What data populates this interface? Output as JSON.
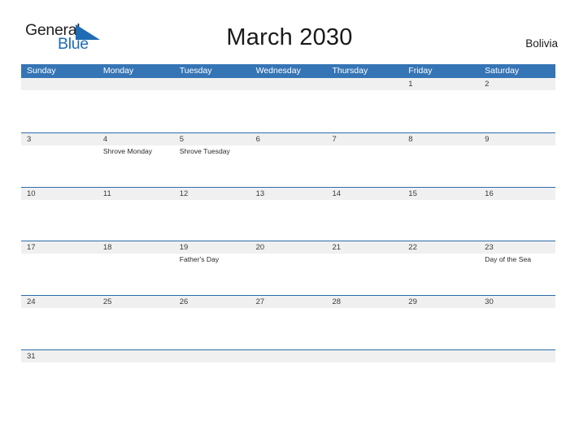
{
  "brand": {
    "name_part1": "General",
    "name_part2": "Blue",
    "flag_icon": "triangle-flag-icon",
    "color_dark": "#231f20",
    "color_blue": "#1f6cb4"
  },
  "header": {
    "title": "March 2030",
    "country": "Bolivia"
  },
  "theme": {
    "header_blue": "#3575b5",
    "separator_blue": "#2c6cab",
    "daynum_band": "#f0f0f0",
    "page_background": "#ffffff"
  },
  "weekdays": [
    "Sunday",
    "Monday",
    "Tuesday",
    "Wednesday",
    "Thursday",
    "Friday",
    "Saturday"
  ],
  "weeks": [
    {
      "days": [
        {
          "num": "",
          "event": ""
        },
        {
          "num": "",
          "event": ""
        },
        {
          "num": "",
          "event": ""
        },
        {
          "num": "",
          "event": ""
        },
        {
          "num": "",
          "event": ""
        },
        {
          "num": "1",
          "event": ""
        },
        {
          "num": "2",
          "event": ""
        }
      ]
    },
    {
      "days": [
        {
          "num": "3",
          "event": ""
        },
        {
          "num": "4",
          "event": "Shrove Monday"
        },
        {
          "num": "5",
          "event": "Shrove Tuesday"
        },
        {
          "num": "6",
          "event": ""
        },
        {
          "num": "7",
          "event": ""
        },
        {
          "num": "8",
          "event": ""
        },
        {
          "num": "9",
          "event": ""
        }
      ]
    },
    {
      "days": [
        {
          "num": "10",
          "event": ""
        },
        {
          "num": "11",
          "event": ""
        },
        {
          "num": "12",
          "event": ""
        },
        {
          "num": "13",
          "event": ""
        },
        {
          "num": "14",
          "event": ""
        },
        {
          "num": "15",
          "event": ""
        },
        {
          "num": "16",
          "event": ""
        }
      ]
    },
    {
      "days": [
        {
          "num": "17",
          "event": ""
        },
        {
          "num": "18",
          "event": ""
        },
        {
          "num": "19",
          "event": "Father's Day"
        },
        {
          "num": "20",
          "event": ""
        },
        {
          "num": "21",
          "event": ""
        },
        {
          "num": "22",
          "event": ""
        },
        {
          "num": "23",
          "event": "Day of the Sea"
        }
      ]
    },
    {
      "days": [
        {
          "num": "24",
          "event": ""
        },
        {
          "num": "25",
          "event": ""
        },
        {
          "num": "26",
          "event": ""
        },
        {
          "num": "27",
          "event": ""
        },
        {
          "num": "28",
          "event": ""
        },
        {
          "num": "29",
          "event": ""
        },
        {
          "num": "30",
          "event": ""
        }
      ]
    },
    {
      "days": [
        {
          "num": "31",
          "event": ""
        },
        {
          "num": "",
          "event": ""
        },
        {
          "num": "",
          "event": ""
        },
        {
          "num": "",
          "event": ""
        },
        {
          "num": "",
          "event": ""
        },
        {
          "num": "",
          "event": ""
        },
        {
          "num": "",
          "event": ""
        }
      ]
    }
  ]
}
